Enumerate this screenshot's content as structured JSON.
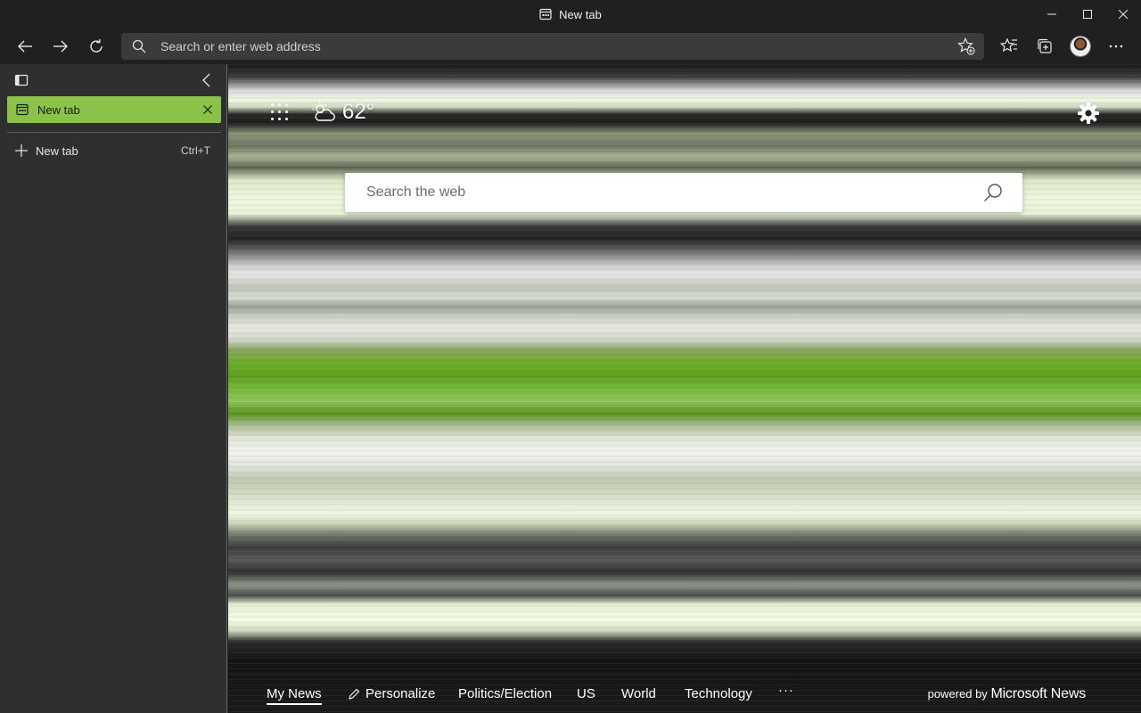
{
  "window": {
    "title": "New tab",
    "controls": [
      "minimize",
      "maximize",
      "close"
    ]
  },
  "toolbar": {
    "address_placeholder": "Search or enter web address",
    "icons": [
      "back-icon",
      "forward-icon",
      "refresh-icon",
      "search-icon",
      "add-favorite-icon",
      "favorites-icon",
      "collections-icon",
      "profile-avatar",
      "more-icon"
    ]
  },
  "sidebar": {
    "active_tab": {
      "label": "New tab"
    },
    "new_tab": {
      "label": "New tab",
      "shortcut": "Ctrl+T"
    }
  },
  "content": {
    "weather": {
      "temperature": "62°",
      "icon": "partly-cloudy-icon"
    },
    "search_placeholder": "Search the web",
    "news_nav": {
      "items": [
        "My News",
        "Personalize",
        "Politics/Election",
        "US",
        "World",
        "Technology"
      ],
      "more": "···",
      "powered_by": "powered by",
      "brand": "Microsoft News"
    }
  },
  "colors": {
    "chrome_bg": "#202020",
    "sidebar_bg": "#2f2f2f",
    "active_tab": "#8bc34a",
    "address_bg": "#3b3b3b"
  }
}
